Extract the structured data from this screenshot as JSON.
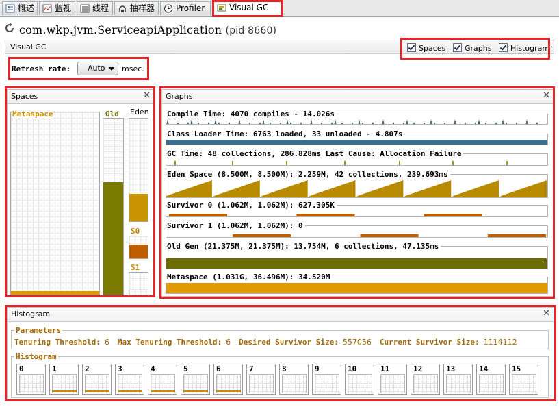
{
  "tabs": [
    {
      "label": "概述",
      "icon": "overview-icon"
    },
    {
      "label": "监视",
      "icon": "monitor-icon"
    },
    {
      "label": "线程",
      "icon": "threads-icon"
    },
    {
      "label": "抽样器",
      "icon": "sampler-icon"
    },
    {
      "label": "Profiler",
      "icon": "profiler-icon"
    },
    {
      "label": "Visual GC",
      "icon": "visual-gc-icon",
      "active": true
    }
  ],
  "app": {
    "title": "com.wkp.jvm.ServiceapiApplication",
    "pid": "(pid 8660)"
  },
  "header": {
    "title": "Visual GC",
    "toggles": [
      {
        "label": "Spaces",
        "checked": true
      },
      {
        "label": "Graphs",
        "checked": true
      },
      {
        "label": "Histogram",
        "checked": true
      }
    ]
  },
  "refresh": {
    "label": "Refresh rate:",
    "value": "Auto",
    "unit": "msec."
  },
  "spaces": {
    "title": "Spaces",
    "metaspace": {
      "label": "Metaspace",
      "fill": 0.02
    },
    "old": {
      "label": "Old",
      "fill": 0.64
    },
    "eden": {
      "label": "Eden",
      "fill": 0.27
    },
    "s0": {
      "label": "S0",
      "fill": 0.62
    },
    "s1": {
      "label": "S1",
      "fill": 0.0
    }
  },
  "graphs": {
    "title": "Graphs",
    "rows": [
      {
        "label": "Compile Time: 4070 compiles - 14.026s",
        "color": "#3b5a73"
      },
      {
        "label": "Class Loader Time: 6763 loaded, 33 unloaded - 4.807s",
        "color": "#3f6d8f"
      },
      {
        "label": "GC Time: 48 collections, 286.828ms Last Cause: Allocation Failure",
        "color": "#8a9a1f"
      },
      {
        "label": "Eden Space (8.500M, 8.500M): 2.259M, 42 collections, 239.693ms",
        "color": "#b88a00"
      },
      {
        "label": "Survivor 0 (1.062M, 1.062M): 627.305K",
        "color": "#c05f00"
      },
      {
        "label": "Survivor 1 (1.062M, 1.062M): 0",
        "color": "#c05f00"
      },
      {
        "label": "Old Gen (21.375M, 21.375M): 13.754M, 6 collections, 47.135ms",
        "color": "#6c6c00"
      },
      {
        "label": "Metaspace (1.031G, 36.496M): 34.520M",
        "color": "#e09a00"
      }
    ]
  },
  "histogram": {
    "title": "Histogram",
    "params_title": "Parameters",
    "params": [
      {
        "name": "Tenuring Threshold:",
        "value": "6"
      },
      {
        "name": "Max Tenuring Threshold:",
        "value": "6"
      },
      {
        "name": "Desired Survivor Size:",
        "value": "557056"
      },
      {
        "name": "Current Survivor Size:",
        "value": "1114112"
      }
    ],
    "hist_title": "Histogram",
    "bins": [
      "0",
      "1",
      "2",
      "3",
      "4",
      "5",
      "6",
      "7",
      "8",
      "9",
      "10",
      "11",
      "12",
      "13",
      "14",
      "15"
    ],
    "bin_fill": [
      0,
      1,
      1,
      1,
      1,
      1,
      1,
      0,
      0,
      0,
      0,
      0,
      0,
      0,
      0,
      0
    ]
  },
  "colors": {
    "highlight": "#e2262a",
    "label": "#a66a00"
  }
}
